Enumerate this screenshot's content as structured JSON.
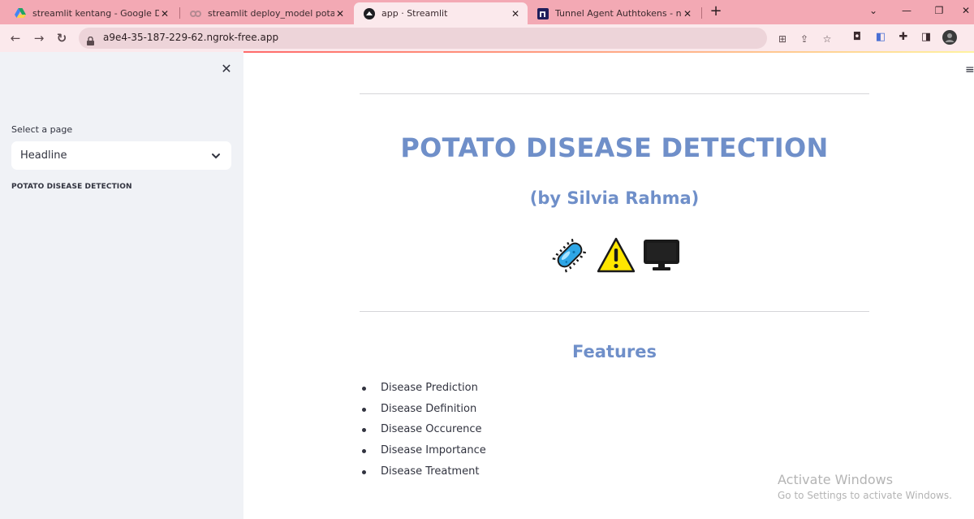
{
  "browser": {
    "tabs": [
      {
        "title": "streamlit kentang - Google Drive",
        "icon": "google-drive-icon",
        "active": false
      },
      {
        "title": "streamlit deploy_model potato d",
        "icon": "colab-icon",
        "active": false
      },
      {
        "title": "app · Streamlit",
        "icon": "streamlit-icon",
        "active": true
      },
      {
        "title": "Tunnel Agent Authtokens - ngrok",
        "icon": "ngrok-icon",
        "active": false
      }
    ],
    "url": "a9e4-35-187-229-62.ngrok-free.app"
  },
  "sidebar": {
    "select_label": "Select a page",
    "select_value": "Headline",
    "heading": "POTATO DISEASE DETECTION"
  },
  "main": {
    "title": "POTATO DISEASE DETECTION",
    "subtitle": "(by Silvia Rahma)",
    "emojis": [
      "microbe-icon",
      "warning-icon",
      "desktop-computer-icon"
    ],
    "features_title": "Features",
    "features": [
      "Disease Prediction",
      "Disease Definition",
      "Disease Occurence",
      "Disease Importance",
      "Disease Treatment"
    ]
  },
  "watermark": {
    "line1": "Activate Windows",
    "line2": "Go to Settings to activate Windows."
  },
  "colors": {
    "tabbar": "#f3a9b4",
    "toolbar": "#fbe9ec",
    "sidebar": "#f0f2f6",
    "accent_title": "#6f8fc9"
  }
}
